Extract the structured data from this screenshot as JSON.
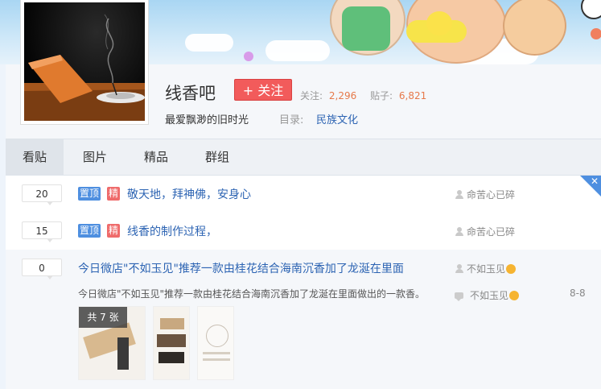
{
  "forum": {
    "title": "线香吧",
    "follow_label": "+ 关注",
    "followers_label": "关注:",
    "followers_value": "2,296",
    "posts_label": "贴子:",
    "posts_value": "6,821",
    "slogan": "最爱飘渺的旧时光",
    "catalog_label": "目录:",
    "catalog_value": "民族文化"
  },
  "tabs": [
    "看贴",
    "图片",
    "精品",
    "群组"
  ],
  "threads": [
    {
      "reply_count": "20",
      "badge_top": "置顶",
      "badge_good": "精",
      "title": "敬天地，拜神佛，安身心",
      "author": "命苦心已碎"
    },
    {
      "reply_count": "15",
      "badge_top": "置顶",
      "badge_good": "精",
      "title": "线香的制作过程，",
      "author": "命苦心已碎"
    },
    {
      "reply_count": "0",
      "title": "今日微店\"不如玉见\"推荐一款由桂花结合海南沉香加了龙涎在里面",
      "author": "不如玉见",
      "abstract": "今日微店\"不如玉见\"推荐一款由桂花结合海南沉香加了龙涎在里面做出的一款香。",
      "last_reply_author": "不如玉见",
      "last_reply_time": "8-8",
      "image_count_label": "共 7 张"
    }
  ],
  "icons": {
    "close": "close-icon",
    "person": "person-icon",
    "reply": "reply-bubble-icon",
    "emoji": "emoji-icon"
  },
  "colors": {
    "follow": "#f25b5b",
    "link": "#2d64b3",
    "badge_top": "#4e8fe0",
    "badge_good": "#ef6a6a",
    "stat_value": "#e6794a"
  }
}
